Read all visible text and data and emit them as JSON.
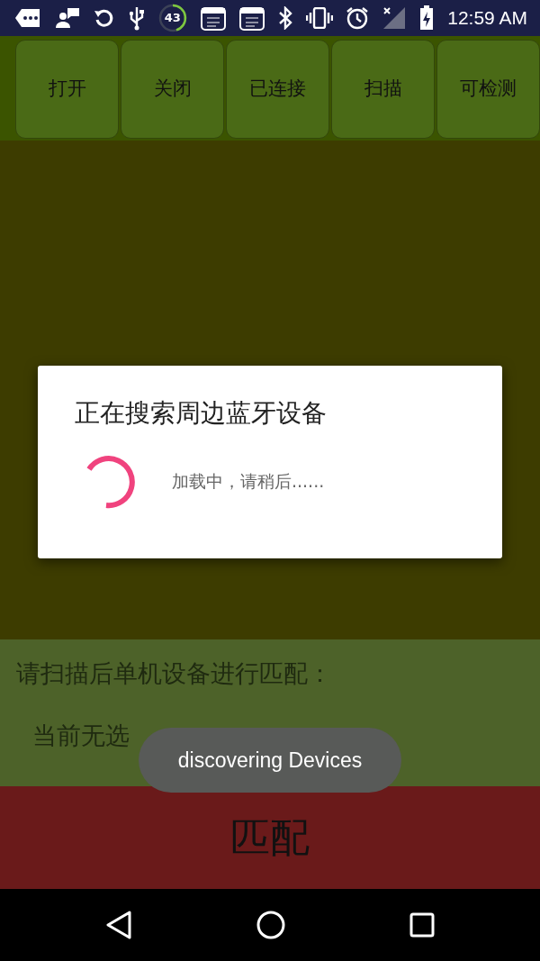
{
  "status_bar": {
    "data_badge": "43",
    "time": "12:59 AM"
  },
  "buttons": [
    {
      "label": "打开"
    },
    {
      "label": "关闭"
    },
    {
      "label": "已连接"
    },
    {
      "label": "扫描"
    },
    {
      "label": "可检测"
    }
  ],
  "pair_section": {
    "prompt": "请扫描后单机设备进行匹配：",
    "device": "当前无选"
  },
  "pair_button": {
    "label": "匹配"
  },
  "dialog": {
    "title": "正在搜索周边蓝牙设备",
    "message": "加载中，请稍后......"
  },
  "toast": {
    "text": "discovering Devices"
  }
}
